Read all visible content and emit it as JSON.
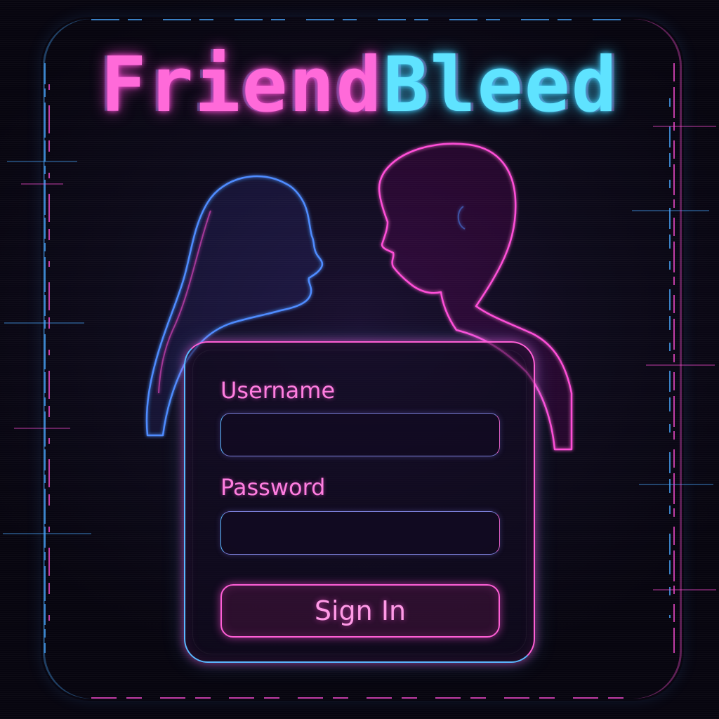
{
  "app": {
    "logo_part_a": "Friend",
    "logo_part_b": "Bleed"
  },
  "login": {
    "username_label": "Username",
    "username_value": "",
    "password_label": "Password",
    "password_value": "",
    "submit_label": "Sign In"
  },
  "colors": {
    "background": "#0a0714",
    "accent_pink": "#ff4fd8",
    "accent_cyan": "#41d2ff",
    "accent_blue": "#5ab8ff"
  },
  "illustration": {
    "description_icon": "couple-silhouette-icon"
  }
}
